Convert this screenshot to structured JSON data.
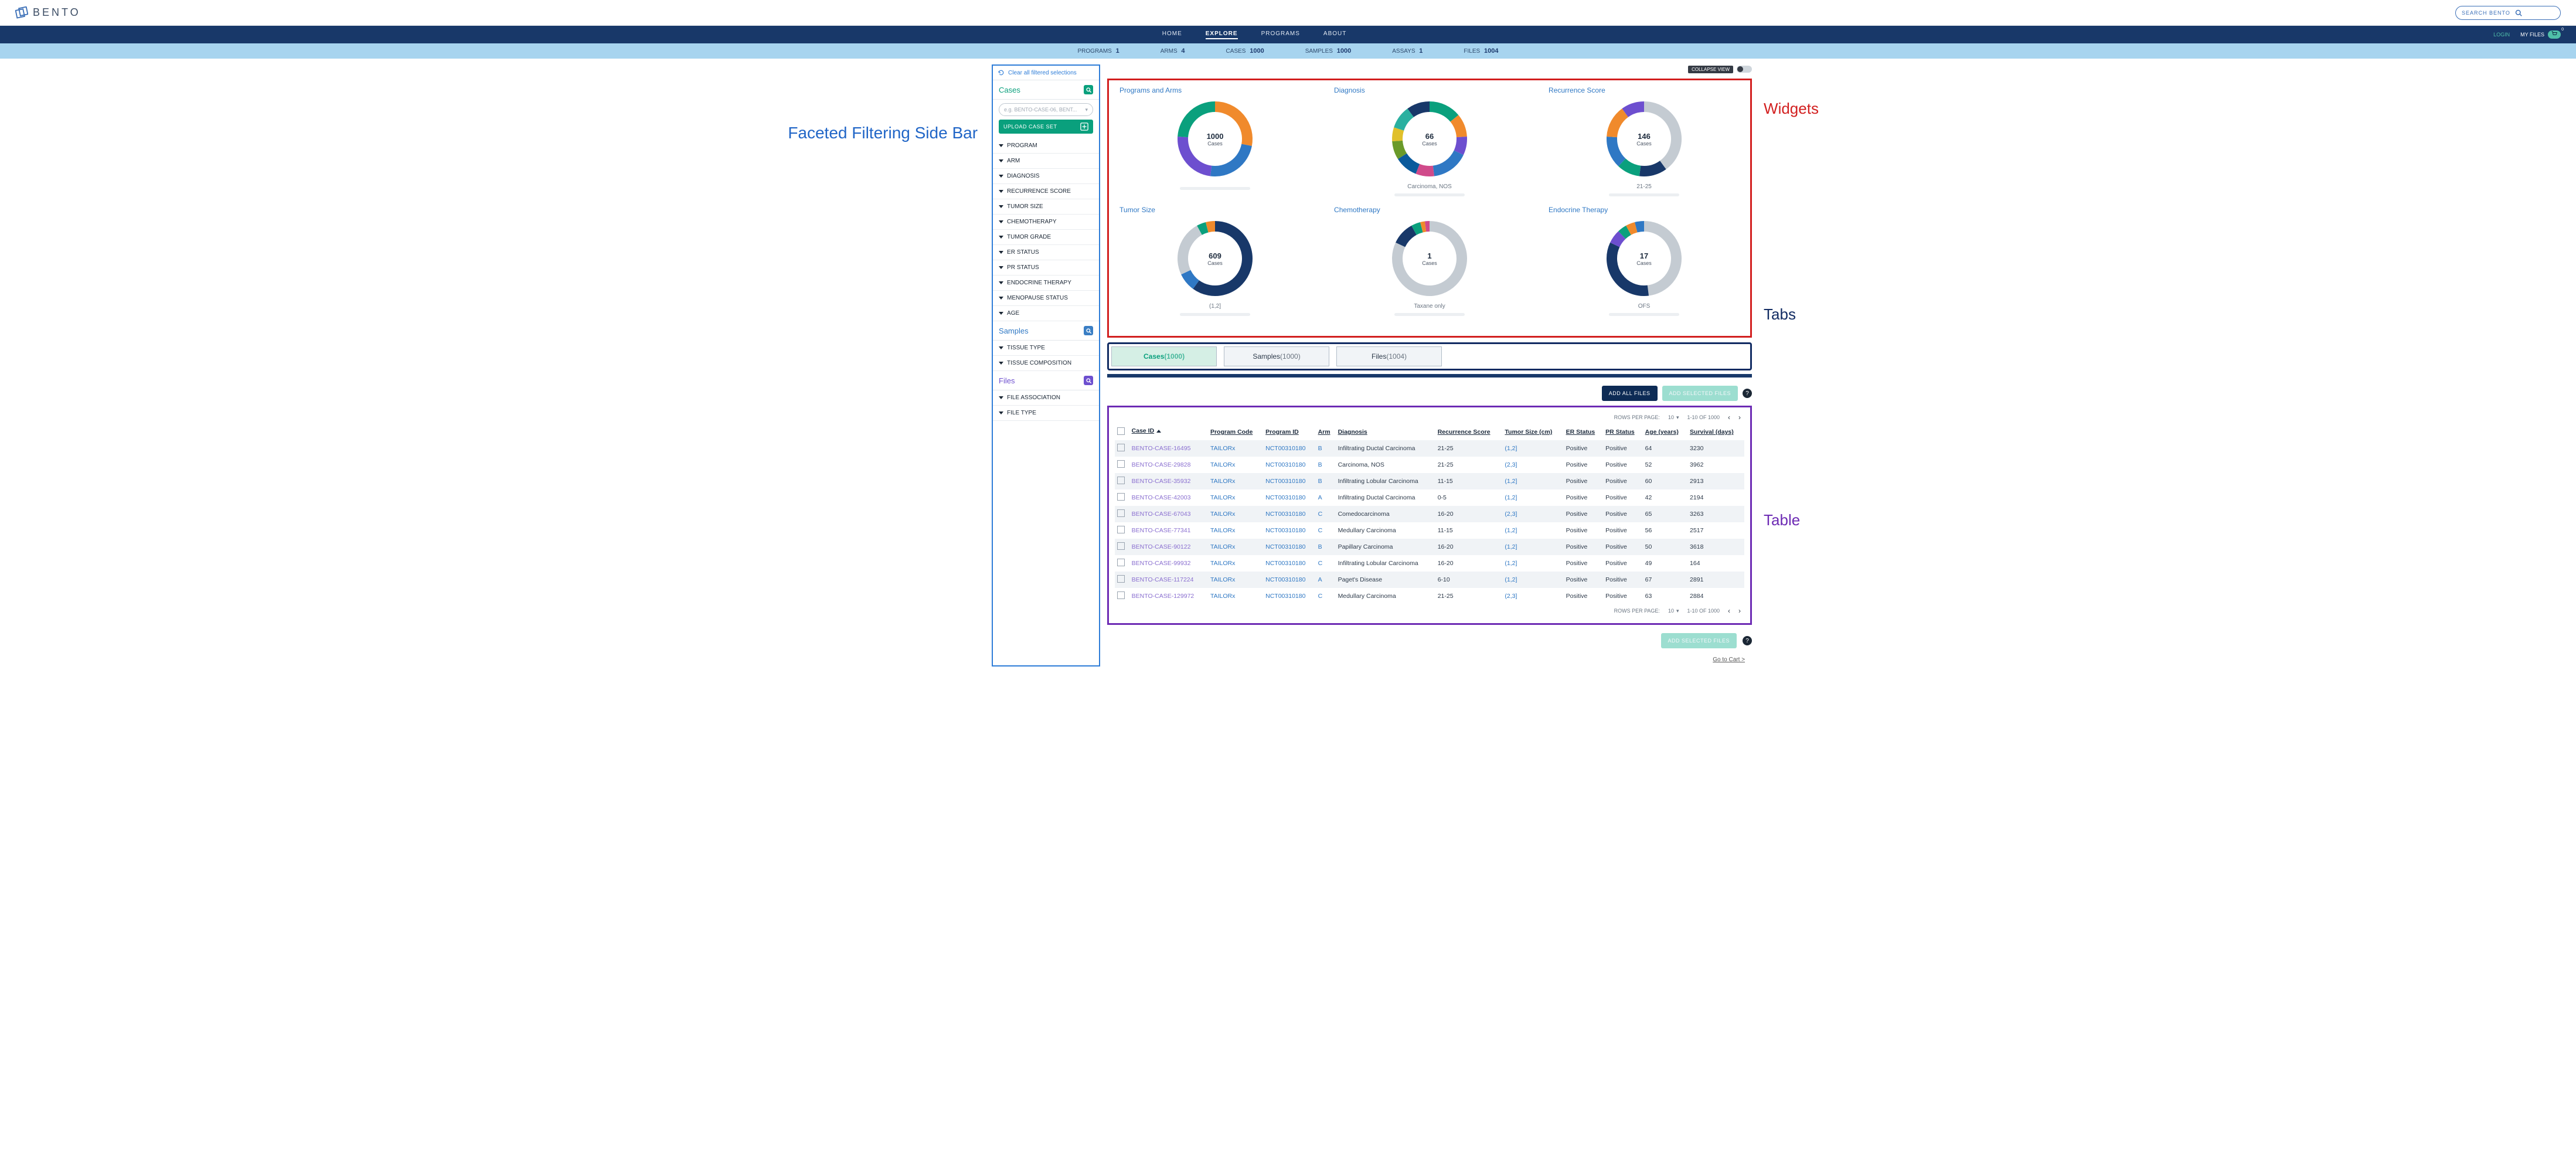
{
  "brand": "BENTO",
  "topbar": {
    "search_placeholder": "SEARCH BENTO"
  },
  "nav": {
    "items": [
      {
        "label": "HOME",
        "active": false
      },
      {
        "label": "EXPLORE",
        "active": true
      },
      {
        "label": "PROGRAMS",
        "active": false
      },
      {
        "label": "ABOUT",
        "active": false
      }
    ],
    "login": "LOGIN",
    "myfiles": "MY FILES",
    "cart_count": "0"
  },
  "stats": [
    {
      "label": "PROGRAMS",
      "value": "1"
    },
    {
      "label": "ARMS",
      "value": "4"
    },
    {
      "label": "CASES",
      "value": "1000"
    },
    {
      "label": "SAMPLES",
      "value": "1000"
    },
    {
      "label": "ASSAYS",
      "value": "1"
    },
    {
      "label": "FILES",
      "value": "1004"
    }
  ],
  "annotations": {
    "sidebar": "Faceted Filtering Side Bar",
    "widgets": "Widgets",
    "tabs": "Tabs",
    "table": "Table"
  },
  "sidebar": {
    "clear": "Clear all filtered selections",
    "groups": [
      {
        "head": "Cases",
        "color": "g",
        "pill": "e.g. BENTO-CASE-06, BENT...",
        "btn": "UPLOAD CASE SET",
        "facets": [
          "PROGRAM",
          "ARM",
          "DIAGNOSIS",
          "RECURRENCE SCORE",
          "TUMOR SIZE",
          "CHEMOTHERAPY",
          "TUMOR GRADE",
          "ER STATUS",
          "PR STATUS",
          "ENDOCRINE THERAPY",
          "MENOPAUSE STATUS",
          "AGE"
        ]
      },
      {
        "head": "Samples",
        "color": "b",
        "facets": [
          "TISSUE TYPE",
          "TISSUE COMPOSITION"
        ]
      },
      {
        "head": "Files",
        "color": "p",
        "facets": [
          "FILE ASSOCIATION",
          "FILE TYPE"
        ]
      }
    ]
  },
  "collapse_label": "COLLAPSE VIEW",
  "chart_data": [
    {
      "title": "Programs and Arms",
      "center_value": "1000",
      "center_label": "Cases",
      "foot": "",
      "slices": [
        {
          "color": "#f08a2c",
          "pct": 28
        },
        {
          "color": "#2f78c4",
          "pct": 24
        },
        {
          "color": "#6d4fcf",
          "pct": 24
        },
        {
          "color": "#0aa07d",
          "pct": 24
        }
      ]
    },
    {
      "title": "Diagnosis",
      "center_value": "66",
      "center_label": "Cases",
      "foot": "Carcinoma, NOS",
      "slices": [
        {
          "color": "#0aa07d",
          "pct": 14
        },
        {
          "color": "#f08a2c",
          "pct": 10
        },
        {
          "color": "#6d4fcf",
          "pct": 8
        },
        {
          "color": "#2f78c4",
          "pct": 16
        },
        {
          "color": "#d04a8a",
          "pct": 8
        },
        {
          "color": "#0a5a9c",
          "pct": 10
        },
        {
          "color": "#6a9a2a",
          "pct": 8
        },
        {
          "color": "#e0c02a",
          "pct": 6
        },
        {
          "color": "#2ab0a0",
          "pct": 10
        },
        {
          "color": "#183869",
          "pct": 10
        }
      ]
    },
    {
      "title": "Recurrence Score",
      "center_value": "146",
      "center_label": "Cases",
      "foot": "21-25",
      "slices": [
        {
          "color": "#c4cbd2",
          "pct": 40
        },
        {
          "color": "#183869",
          "pct": 12
        },
        {
          "color": "#0aa07d",
          "pct": 10
        },
        {
          "color": "#2f78c4",
          "pct": 14
        },
        {
          "color": "#f08a2c",
          "pct": 14
        },
        {
          "color": "#6d4fcf",
          "pct": 10
        }
      ]
    },
    {
      "title": "Tumor Size",
      "center_value": "609",
      "center_label": "Cases",
      "foot": "(1,2]",
      "slices": [
        {
          "color": "#183869",
          "pct": 60
        },
        {
          "color": "#2f78c4",
          "pct": 8
        },
        {
          "color": "#c4cbd2",
          "pct": 24
        },
        {
          "color": "#0aa07d",
          "pct": 4
        },
        {
          "color": "#f08a2c",
          "pct": 4
        }
      ]
    },
    {
      "title": "Chemotherapy",
      "center_value": "1",
      "center_label": "Cases",
      "foot": "Taxane only",
      "slices": [
        {
          "color": "#c4cbd2",
          "pct": 82
        },
        {
          "color": "#183869",
          "pct": 10
        },
        {
          "color": "#0aa07d",
          "pct": 4
        },
        {
          "color": "#f08a2c",
          "pct": 2
        },
        {
          "color": "#d04a8a",
          "pct": 2
        }
      ]
    },
    {
      "title": "Endocrine Therapy",
      "center_value": "17",
      "center_label": "Cases",
      "foot": "OFS",
      "slices": [
        {
          "color": "#c4cbd2",
          "pct": 48
        },
        {
          "color": "#183869",
          "pct": 34
        },
        {
          "color": "#6d4fcf",
          "pct": 6
        },
        {
          "color": "#0aa07d",
          "pct": 4
        },
        {
          "color": "#f08a2c",
          "pct": 4
        },
        {
          "color": "#2f78c4",
          "pct": 4
        }
      ]
    }
  ],
  "tabs": {
    "items": [
      {
        "label": "Cases",
        "count": "1000",
        "active": true
      },
      {
        "label": "Samples",
        "count": "1000",
        "active": false
      },
      {
        "label": "Files",
        "count": "1004",
        "active": false
      }
    ]
  },
  "file_buttons": {
    "add_all": "ADD ALL FILES",
    "add_sel": "ADD SELECTED FILES"
  },
  "pager": {
    "rpp_label": "ROWS PER PAGE:",
    "rpp_value": "10",
    "range": "1-10 OF 1000"
  },
  "table": {
    "cols": [
      "Case ID",
      "Program Code",
      "Program ID",
      "Arm",
      "Diagnosis",
      "Recurrence Score",
      "Tumor Size (cm)",
      "ER Status",
      "PR Status",
      "Age (years)",
      "Survival (days)"
    ],
    "rows": [
      {
        "cid": "BENTO-CASE-16495",
        "prog": "TAILORx",
        "pid": "NCT00310180",
        "arm": "B",
        "diag": "Infiltrating Ductal Carcinoma",
        "rec": "21-25",
        "ts": "(1,2]",
        "er": "Positive",
        "pr": "Positive",
        "age": "64",
        "surv": "3230"
      },
      {
        "cid": "BENTO-CASE-29828",
        "prog": "TAILORx",
        "pid": "NCT00310180",
        "arm": "B",
        "diag": "Carcinoma, NOS",
        "rec": "21-25",
        "ts": "(2,3]",
        "er": "Positive",
        "pr": "Positive",
        "age": "52",
        "surv": "3962"
      },
      {
        "cid": "BENTO-CASE-35932",
        "prog": "TAILORx",
        "pid": "NCT00310180",
        "arm": "B",
        "diag": "Infiltrating Lobular Carcinoma",
        "rec": "11-15",
        "ts": "(1,2]",
        "er": "Positive",
        "pr": "Positive",
        "age": "60",
        "surv": "2913"
      },
      {
        "cid": "BENTO-CASE-42003",
        "prog": "TAILORx",
        "pid": "NCT00310180",
        "arm": "A",
        "diag": "Infiltrating Ductal Carcinoma",
        "rec": "0-5",
        "ts": "(1,2]",
        "er": "Positive",
        "pr": "Positive",
        "age": "42",
        "surv": "2194"
      },
      {
        "cid": "BENTO-CASE-67043",
        "prog": "TAILORx",
        "pid": "NCT00310180",
        "arm": "C",
        "diag": "Comedocarcinoma",
        "rec": "16-20",
        "ts": "(2,3]",
        "er": "Positive",
        "pr": "Positive",
        "age": "65",
        "surv": "3263"
      },
      {
        "cid": "BENTO-CASE-77341",
        "prog": "TAILORx",
        "pid": "NCT00310180",
        "arm": "C",
        "diag": "Medullary Carcinoma",
        "rec": "11-15",
        "ts": "(1,2]",
        "er": "Positive",
        "pr": "Positive",
        "age": "56",
        "surv": "2517"
      },
      {
        "cid": "BENTO-CASE-90122",
        "prog": "TAILORx",
        "pid": "NCT00310180",
        "arm": "B",
        "diag": "Papillary Carcinoma",
        "rec": "16-20",
        "ts": "(1,2]",
        "er": "Positive",
        "pr": "Positive",
        "age": "50",
        "surv": "3618"
      },
      {
        "cid": "BENTO-CASE-99932",
        "prog": "TAILORx",
        "pid": "NCT00310180",
        "arm": "C",
        "diag": "Infiltrating Lobular Carcinoma",
        "rec": "16-20",
        "ts": "(1,2]",
        "er": "Positive",
        "pr": "Positive",
        "age": "49",
        "surv": "164"
      },
      {
        "cid": "BENTO-CASE-117224",
        "prog": "TAILORx",
        "pid": "NCT00310180",
        "arm": "A",
        "diag": "Paget's Disease",
        "rec": "6-10",
        "ts": "(1,2]",
        "er": "Positive",
        "pr": "Positive",
        "age": "67",
        "surv": "2891"
      },
      {
        "cid": "BENTO-CASE-129972",
        "prog": "TAILORx",
        "pid": "NCT00310180",
        "arm": "C",
        "diag": "Medullary Carcinoma",
        "rec": "21-25",
        "ts": "(2,3]",
        "er": "Positive",
        "pr": "Positive",
        "age": "63",
        "surv": "2884"
      }
    ]
  },
  "cart_link": "Go to Cart >"
}
